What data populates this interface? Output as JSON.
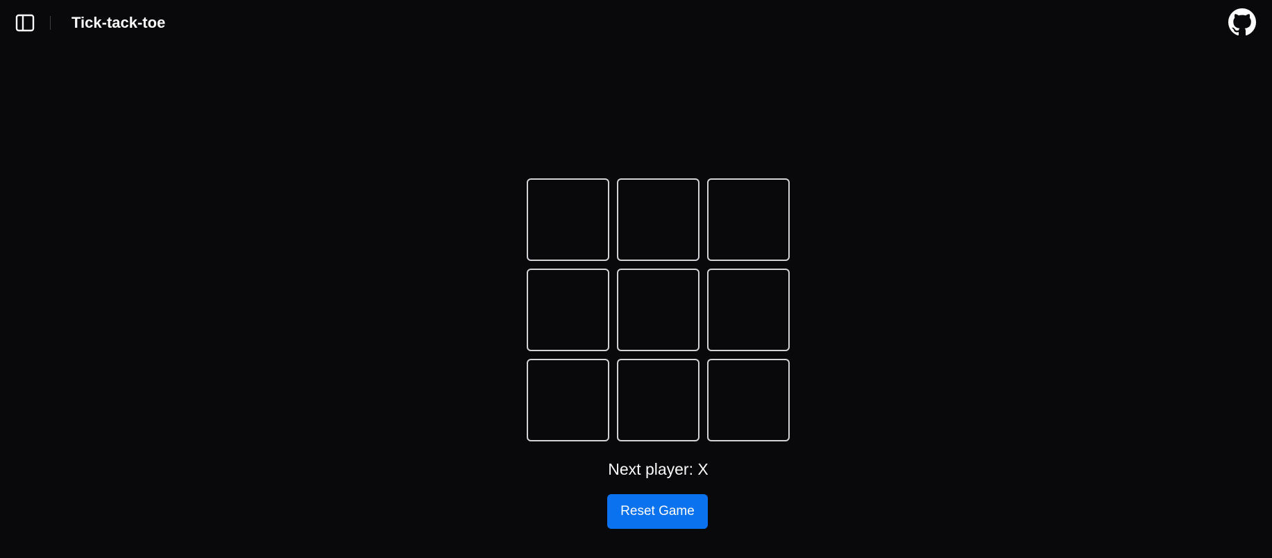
{
  "header": {
    "title": "Tick-tack-toe",
    "sidebar_toggle_icon": "sidebar-panel-icon",
    "github_icon": "github-icon"
  },
  "game": {
    "board": [
      "",
      "",
      "",
      "",
      "",
      "",
      "",
      "",
      ""
    ],
    "status_text": "Next player: X",
    "reset_label": "Reset Game"
  },
  "colors": {
    "background": "#09090b",
    "cell_border": "#d4d4d8",
    "accent": "#0a72ef",
    "text": "#fafafa"
  }
}
